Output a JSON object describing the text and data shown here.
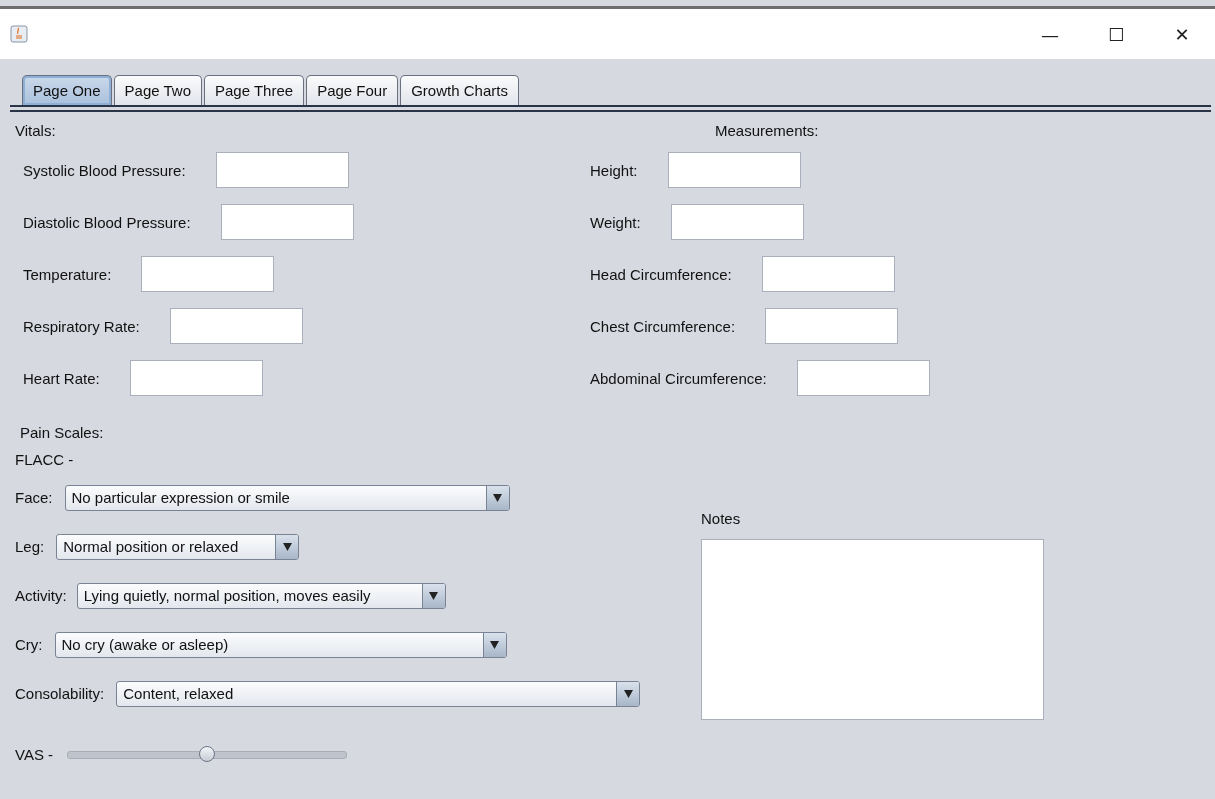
{
  "window": {
    "controls": [
      "—",
      "☐",
      "✕"
    ]
  },
  "tabs": [
    {
      "label": "Page One",
      "selected": true
    },
    {
      "label": "Page Two",
      "selected": false
    },
    {
      "label": "Page Three",
      "selected": false
    },
    {
      "label": "Page Four",
      "selected": false
    },
    {
      "label": "Growth Charts",
      "selected": false
    }
  ],
  "vitals": {
    "title": "Vitals:",
    "fields": [
      {
        "label": "Systolic Blood Pressure:"
      },
      {
        "label": "Diastolic Blood Pressure:"
      },
      {
        "label": "Temperature:"
      },
      {
        "label": "Respiratory Rate:"
      },
      {
        "label": "Heart Rate:"
      }
    ]
  },
  "measurements": {
    "title": "Measurements:",
    "fields": [
      {
        "label": "Height:"
      },
      {
        "label": "Weight:"
      },
      {
        "label": "Head Circumference:"
      },
      {
        "label": "Chest Circumference:"
      },
      {
        "label": "Abdominal Circumference:"
      }
    ]
  },
  "pain_scales": {
    "title": "Pain Scales:",
    "flacc_title": "FLACC -",
    "dropdowns": [
      {
        "label": "Face:",
        "value": "No particular expression or smile"
      },
      {
        "label": "Leg:",
        "value": "Normal position or relaxed"
      },
      {
        "label": "Activity:",
        "value": "Lying quietly, normal position, moves easily"
      },
      {
        "label": "Cry:",
        "value": "No cry (awake or asleep)"
      },
      {
        "label": "Consolability:",
        "value": "Content, relaxed"
      }
    ],
    "vas": {
      "label": "VAS -",
      "level": 0.5
    }
  },
  "notes": {
    "label": "Notes"
  }
}
